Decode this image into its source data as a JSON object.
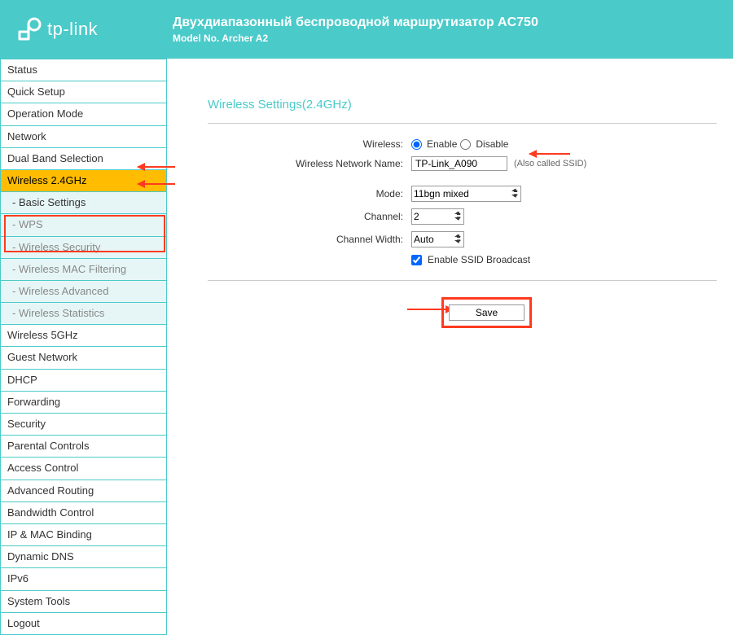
{
  "header": {
    "brand": "tp-link",
    "title": "Двухдиапазонный беспроводной маршрутизатор AC750",
    "model": "Model No. Archer A2"
  },
  "nav": {
    "status": "Status",
    "quick_setup": "Quick Setup",
    "operation_mode": "Operation Mode",
    "network": "Network",
    "dual_band": "Dual Band Selection",
    "wireless_24": "Wireless 2.4GHz",
    "basic_settings": "- Basic Settings",
    "wps": "- WPS",
    "wireless_security": "- Wireless Security",
    "mac_filtering": "- Wireless MAC Filtering",
    "wireless_advanced": "- Wireless Advanced",
    "wireless_statistics": "- Wireless Statistics",
    "wireless_5": "Wireless 5GHz",
    "guest_network": "Guest Network",
    "dhcp": "DHCP",
    "forwarding": "Forwarding",
    "security": "Security",
    "parental": "Parental Controls",
    "access_control": "Access Control",
    "advanced_routing": "Advanced Routing",
    "bandwidth": "Bandwidth Control",
    "ip_mac": "IP & MAC Binding",
    "dynamic_dns": "Dynamic DNS",
    "ipv6": "IPv6",
    "system_tools": "System Tools",
    "logout": "Logout"
  },
  "panel": {
    "title": "Wireless Settings(2.4GHz)",
    "labels": {
      "wireless": "Wireless:",
      "enable": "Enable",
      "disable": "Disable",
      "network_name": "Wireless Network Name:",
      "ssid_note": "(Also called SSID)",
      "mode": "Mode:",
      "channel": "Channel:",
      "channel_width": "Channel Width:",
      "broadcast": "Enable SSID Broadcast"
    },
    "values": {
      "network_name": "TP-Link_A090",
      "mode": "11bgn mixed",
      "channel": "2",
      "channel_width": "Auto"
    },
    "save": "Save"
  }
}
